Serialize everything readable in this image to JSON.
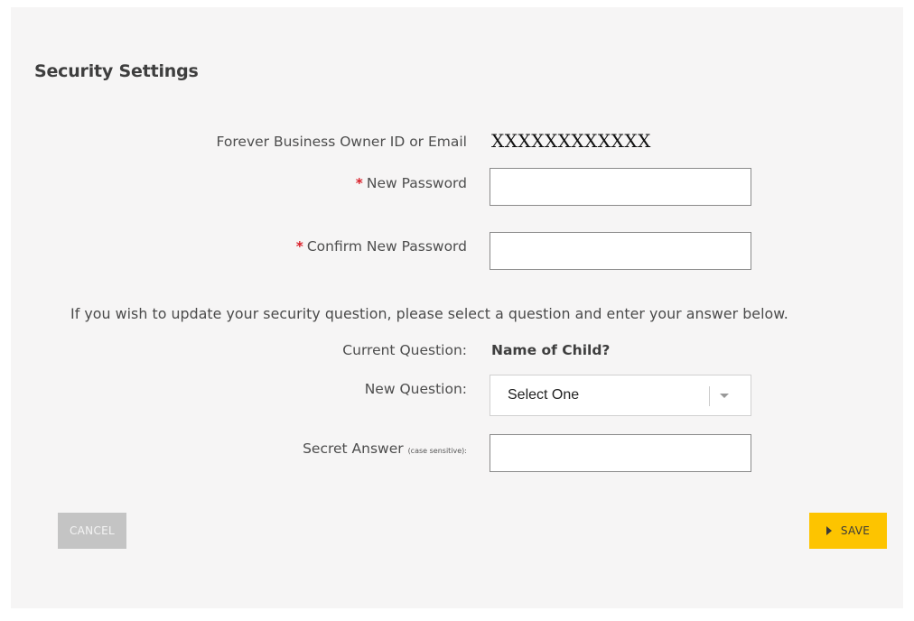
{
  "page": {
    "title": "Security Settings"
  },
  "form": {
    "id_label": "Forever Business Owner ID or Email",
    "id_value": "XXXXXXXXXXXX",
    "required_marker": "*",
    "new_password_label": "New Password",
    "new_password_value": "",
    "confirm_password_label": "Confirm New Password",
    "confirm_password_value": "",
    "security_info": "If you wish to update your security question, please select a question and enter your answer below.",
    "current_question_label": "Current Question:",
    "current_question_value": "Name of Child?",
    "new_question_label": "New Question:",
    "new_question_selected": "Select One",
    "secret_answer_label": "Secret Answer",
    "secret_answer_note": "(case sensitive):",
    "secret_answer_value": ""
  },
  "actions": {
    "cancel_label": "CANCEL",
    "save_label": "SAVE"
  },
  "colors": {
    "panel_bg": "#f6f5f5",
    "required": "#d9202a",
    "save_bg": "#fdc400",
    "cancel_bg": "#c4c4c4"
  },
  "icons": {
    "save": "play-icon",
    "select": "chevron-down-icon"
  }
}
